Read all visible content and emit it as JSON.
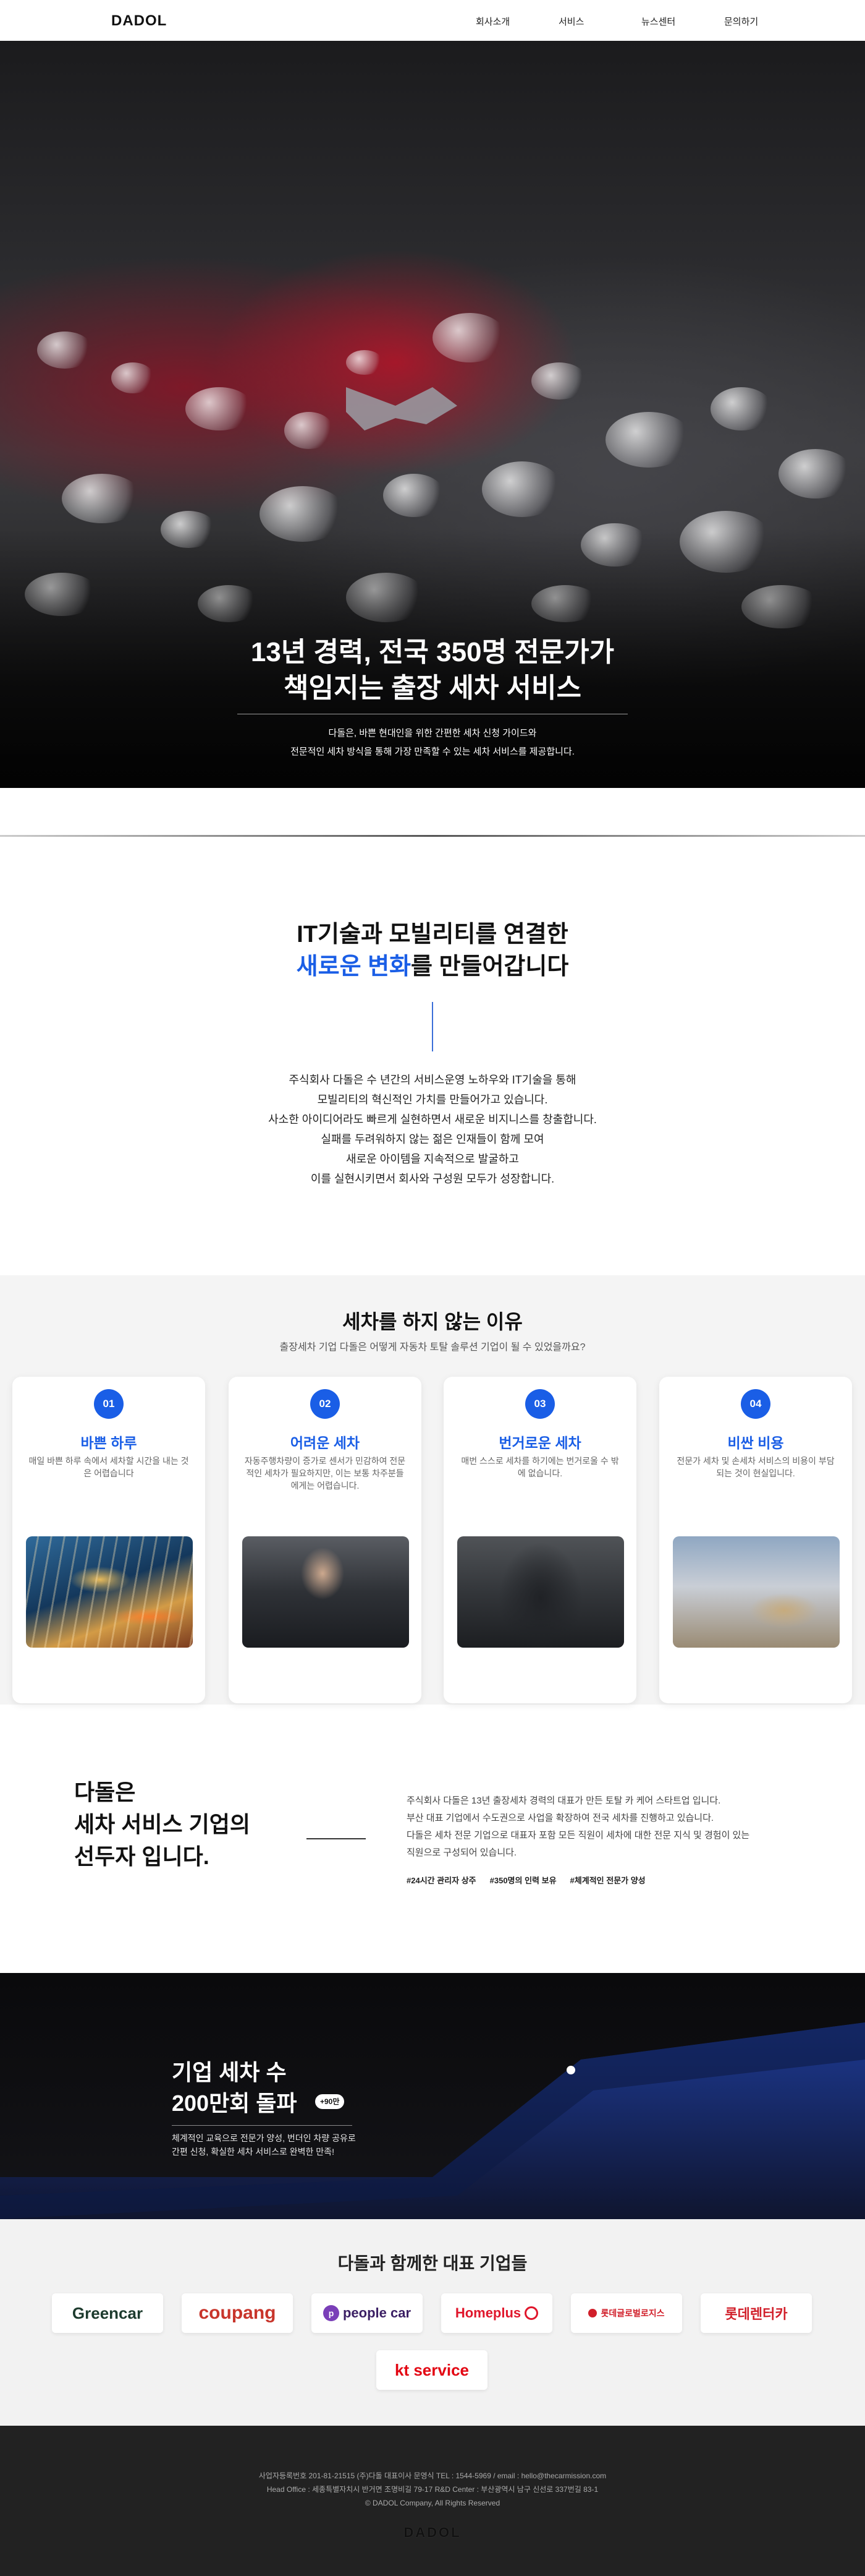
{
  "nav": {
    "logo": "DADOL",
    "items": [
      "회사소개",
      "서비스",
      "뉴스센터",
      "문의하기"
    ]
  },
  "hero": {
    "title_line1": "13년 경력, 전국 350명 전문가가",
    "title_line2": "책임지는 출장 세차 서비스",
    "desc_line1": "다돌은, 바쁜 현대인을 위한 간편한 세차 신청 가이드와",
    "desc_line2": "전문적인 세차 방식을 통해 가장 만족할 수 있는 세차 서비스를 제공합니다."
  },
  "intro": {
    "title_line1": "IT기술과 모빌리티를 연결한",
    "title_highlight": "새로운 변화",
    "title_rest": "를 만들어갑니다",
    "desc": [
      "주식회사 다돌은 수 년간의 서비스운영 노하우와 IT기술을 통해",
      "모빌리티의 혁신적인 가치를 만들어가고 있습니다.",
      "사소한 아이디어라도 빠르게 실현하면서 새로운 비지니스를 창출합니다.",
      "실패를 두려워하지 않는 젊은 인재들이 함께 모여",
      "새로운 아이템을 지속적으로 발굴하고",
      "이를 실현시키면서 회사와 구성원 모두가 성장합니다."
    ]
  },
  "reasons": {
    "title": "세차를 하지 않는 이유",
    "subtitle": "출장세차 기업 다돌은 어떻게 자동차 토탈 솔루션 기업이 될 수 있었을까요?",
    "cards": [
      {
        "num": "01",
        "title": "바쁜 하루",
        "desc": "매일 바쁜 하루 속에서 세차할 시간을 내는 것은 어렵습니다"
      },
      {
        "num": "02",
        "title": "어려운 세차",
        "desc": "자동주행차량이 증가로 센서가 민감하여 전문적인 세차가 필요하지만, 이는 보통 차주분들에게는 어렵습니다."
      },
      {
        "num": "03",
        "title": "번거로운 세차",
        "desc": "매번 스스로 세차를 하기에는 번거로울 수 밖에 없습니다."
      },
      {
        "num": "04",
        "title": "비싼 비용",
        "desc": "전문가 세차 및 손세차 서비스의 비용이 부담되는 것이 현실입니다."
      }
    ]
  },
  "leader": {
    "title_line1": "다돌은",
    "title_line2": "세차 서비스 기업의",
    "title_line3": "선두자 입니다.",
    "desc": [
      "주식회사 다돌은 13년 출장세차 경력의 대표가 만든 토탈 카 케어 스타트업 입니다.",
      "부산 대표 기업에서 수도권으로 사업을 확장하여 전국 세차를 진행하고 있습니다.",
      "다돌은 세차 전문 기업으로 대표자 포함 모든 직원이 세차에 대한 전문 지식 및 경험이 있는",
      "직원으로 구성되어 있습니다."
    ],
    "tags": [
      "#24시간 관리자 상주",
      "#350명의 인력 보유",
      "#체계적인 전문가 양성"
    ]
  },
  "banner": {
    "title_line1": "기업 세차 수",
    "title_line2": "200만회 돌파",
    "badge": "+90만",
    "desc_line1": "체계적인 교육으로 전문가 양성, 번더인 차량 공유로",
    "desc_line2": "간편 신청, 확실한 세차 서비스로 완벽한 만족!"
  },
  "partners": {
    "title": "다돌과 함께한 대표 기업들",
    "logos": [
      {
        "name": "Greencar",
        "color": "#1d3b2e"
      },
      {
        "name": "coupang",
        "color": "#c8352b"
      },
      {
        "name": "people car",
        "color": "#3b1f64"
      },
      {
        "name": "Homeplus",
        "color": "#e0162b"
      },
      {
        "name": "롯데글로벌로지스",
        "color": "#d11f2a"
      },
      {
        "name": "롯데렌터카",
        "color": "#d11f2a"
      },
      {
        "name": "kt service",
        "color": "#e30613"
      }
    ]
  },
  "footer": {
    "line1": "사업자등록번호 201-81-21515        (주)다돌 대표이사 문영식        TEL : 1544-5969 / email : hello@thecarmission.com",
    "line2": "Head Office : 세종특별자치시 반거면 조명비길 79-17        R&D Center : 부산광역시 남구 신선로 337번길 83-1",
    "line3": "© DADOL Company, All Rights Reserved",
    "logo": "DADOL"
  }
}
